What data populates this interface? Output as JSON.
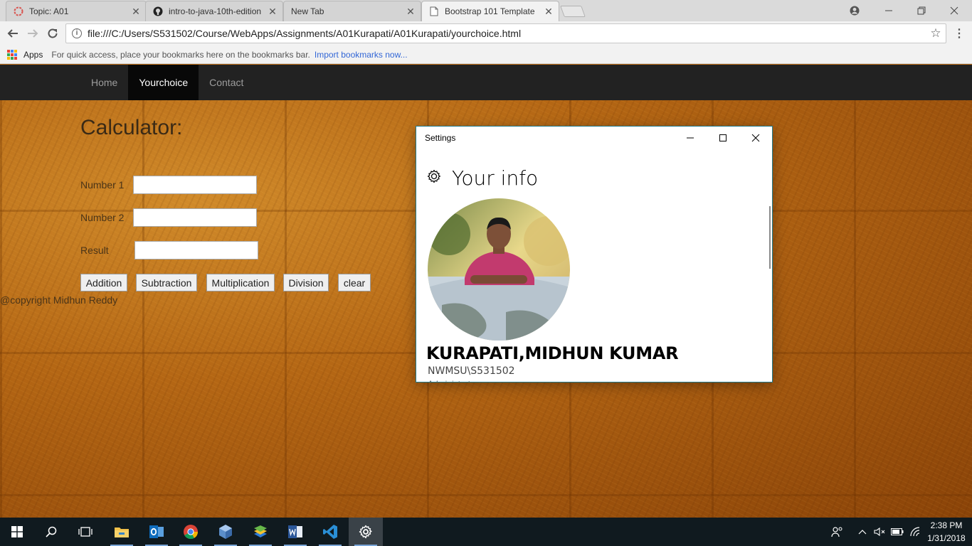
{
  "browser": {
    "tabs": [
      {
        "title": "Topic: A01",
        "icon": "discourse-icon"
      },
      {
        "title": "intro-to-java-10th-edition",
        "icon": "github-icon"
      },
      {
        "title": "New Tab",
        "icon": "none"
      },
      {
        "title": "Bootstrap 101 Template",
        "icon": "page-icon"
      }
    ],
    "active_tab": 3,
    "url": "file:///C:/Users/S531502/Course/WebApps/Assignments/A01Kurapati/A01Kurapati/yourchoice.html",
    "bookmarks": {
      "apps_label": "Apps",
      "hint": "For quick access, place your bookmarks here on the bookmarks bar.",
      "import_link": "Import bookmarks now..."
    }
  },
  "page": {
    "nav": [
      {
        "label": "Home",
        "active": false
      },
      {
        "label": "Yourchoice",
        "active": true
      },
      {
        "label": "Contact",
        "active": false
      }
    ],
    "calculator": {
      "title": "Calculator:",
      "number1_label": "Number 1",
      "number2_label": "Number 2",
      "result_label": "Result",
      "number1_value": "",
      "number2_value": "",
      "result_value": "",
      "buttons": {
        "addition": "Addition",
        "subtraction": "Subtraction",
        "multiplication": "Multiplication",
        "division": "Division",
        "clear": "clear"
      }
    },
    "copyright": "@copyright Midhun Reddy"
  },
  "settings_window": {
    "title": "Settings",
    "heading": "Your info",
    "user_name": "KURAPATI,MIDHUN KUMAR",
    "account": "NWMSU\\S531502",
    "role": "Administrator"
  },
  "taskbar": {
    "apps": [
      "file-explorer-icon",
      "outlook-icon",
      "chrome-icon",
      "virtualbox-icon",
      "bluestacks-icon",
      "word-icon",
      "vscode-icon",
      "settings-icon"
    ],
    "time": "2:38 PM",
    "date": "1/31/2018"
  },
  "colors": {
    "navbar": "#222222",
    "navbar_active": "#080808",
    "settings_border": "#1f7a8c",
    "taskbar": "#101a1f",
    "link": "#3367d6"
  }
}
